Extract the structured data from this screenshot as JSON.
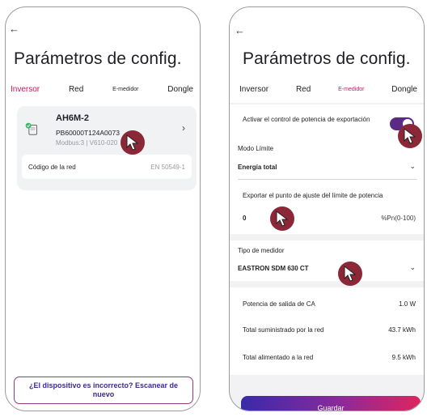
{
  "left": {
    "title": "Parámetros de config.",
    "tabs": [
      {
        "label": "Inversor",
        "active": true
      },
      {
        "label": "Red",
        "active": false
      },
      {
        "label": "E-medidor",
        "active": false
      },
      {
        "label": "Dongle",
        "active": false
      }
    ],
    "device": {
      "name": "AH6M-2",
      "serial": "PB60000T124A0073",
      "firmware": "Modbus:3 | V610-020"
    },
    "grid_code": {
      "label": "Código de la red",
      "value": "EN 50549-1"
    },
    "scan_button": "¿El dispositivo es incorrecto? Escanear de nuevo"
  },
  "right": {
    "title": "Parámetros de config.",
    "tabs": [
      {
        "label": "Inversor",
        "active": false
      },
      {
        "label": "Red",
        "active": false
      },
      {
        "label": "E-medidor",
        "active": true
      },
      {
        "label": "Dongle",
        "active": false
      }
    ],
    "export_control": {
      "label": "Activar el control de potencia de exportación",
      "enabled": true
    },
    "limit_mode": {
      "label": "Modo Límite",
      "value": "Energía total"
    },
    "export_setpoint": {
      "label": "Exportar el punto de ajuste del límite de potencia",
      "value": "0",
      "unit_range": "%Pn(0-100)"
    },
    "meter_type": {
      "label": "Tipo de medidor",
      "value": "EASTRON SDM 630 CT"
    },
    "metrics": [
      {
        "label": "Potencia de salida de CA",
        "value": "1.0 W"
      },
      {
        "label": "Total suministrado por la red",
        "value": "43.7 kWh"
      },
      {
        "label": "Total alimentado a la red",
        "value": "9.5 kWh"
      }
    ],
    "save_button": "Guardar"
  },
  "colors": {
    "accent": "#c2185b",
    "toggle": "#5b2a86",
    "cursor": "#8b2737",
    "gradient_start": "#3a2aa8",
    "gradient_end": "#e0245e"
  }
}
